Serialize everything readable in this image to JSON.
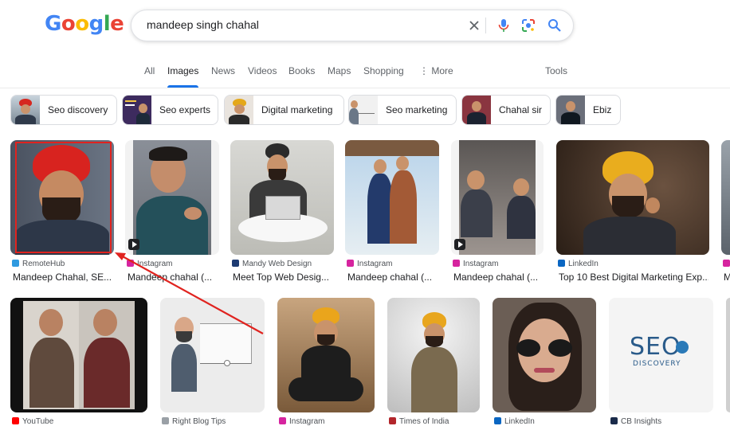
{
  "logo": "Google",
  "search": {
    "query": "mandeep singh chahal"
  },
  "tabs": [
    {
      "label": "All"
    },
    {
      "label": "Images"
    },
    {
      "label": "News"
    },
    {
      "label": "Videos"
    },
    {
      "label": "Books"
    },
    {
      "label": "Maps"
    },
    {
      "label": "Shopping"
    },
    {
      "label": "More"
    }
  ],
  "tools_label": "Tools",
  "chips": [
    {
      "label": "Seo discovery"
    },
    {
      "label": "Seo experts"
    },
    {
      "label": "Digital marketing"
    },
    {
      "label": "Seo marketing"
    },
    {
      "label": "Chahal sir"
    },
    {
      "label": "Ebiz"
    }
  ],
  "row1": [
    {
      "source": "RemoteHub",
      "title": "Mandeep Chahal, SE..."
    },
    {
      "source": "Instagram",
      "title": "Mandeep chahal (..."
    },
    {
      "source": "Mandy Web Design",
      "title": "Meet Top Web Desig..."
    },
    {
      "source": "Instagram",
      "title": "Mandeep chahal (..."
    },
    {
      "source": "Instagram",
      "title": "Mandeep chahal (..."
    },
    {
      "source": "LinkedIn",
      "title": "Top 10 Best Digital Marketing Exp..."
    },
    {
      "source": "",
      "title": "M"
    }
  ],
  "row2": [
    {
      "source": "YouTube"
    },
    {
      "source": "Right Blog Tips"
    },
    {
      "source": "Instagram"
    },
    {
      "source": "Times of India"
    },
    {
      "source": "LinkedIn"
    },
    {
      "source": "CB Insights"
    }
  ],
  "seo_logo": {
    "top": "SEO",
    "bottom": "DISCOVERY"
  },
  "colors": {
    "accent": "#1a73e8",
    "highlight": "#e0231f"
  }
}
